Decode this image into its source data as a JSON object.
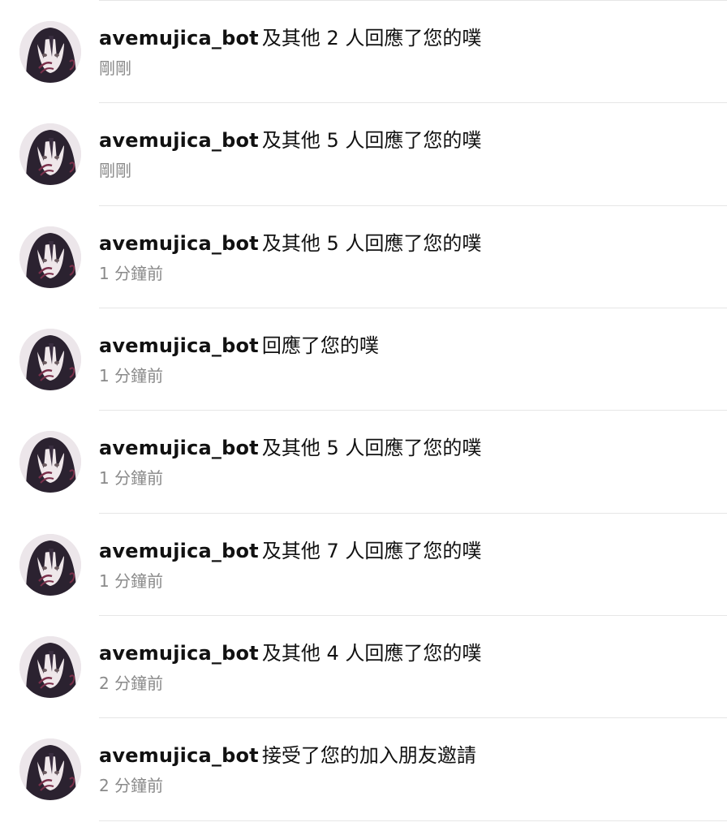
{
  "notifications": [
    {
      "username": "avemujica_bot",
      "action": "及其他 2 人回應了您的噗",
      "time": "剛剛"
    },
    {
      "username": "avemujica_bot",
      "action": "及其他 5 人回應了您的噗",
      "time": "剛剛"
    },
    {
      "username": "avemujica_bot",
      "action": "及其他 5 人回應了您的噗",
      "time": "1 分鐘前"
    },
    {
      "username": "avemujica_bot",
      "action": "回應了您的噗",
      "time": "1 分鐘前"
    },
    {
      "username": "avemujica_bot",
      "action": "及其他 5 人回應了您的噗",
      "time": "1 分鐘前"
    },
    {
      "username": "avemujica_bot",
      "action": "及其他 7 人回應了您的噗",
      "time": "1 分鐘前"
    },
    {
      "username": "avemujica_bot",
      "action": "及其他 4 人回應了您的噗",
      "time": "2 分鐘前"
    },
    {
      "username": "avemujica_bot",
      "action": "接受了您的加入朋友邀請",
      "time": "2 分鐘前"
    }
  ],
  "colors": {
    "text_primary": "#111111",
    "text_secondary": "#8a8a8a",
    "divider": "#e6e6e6",
    "avatar_hair": "#2b2230",
    "avatar_skin": "#efe7ea",
    "avatar_accent": "#7a2f4a"
  },
  "icons": {
    "avatar": "anime-character-avatar"
  }
}
